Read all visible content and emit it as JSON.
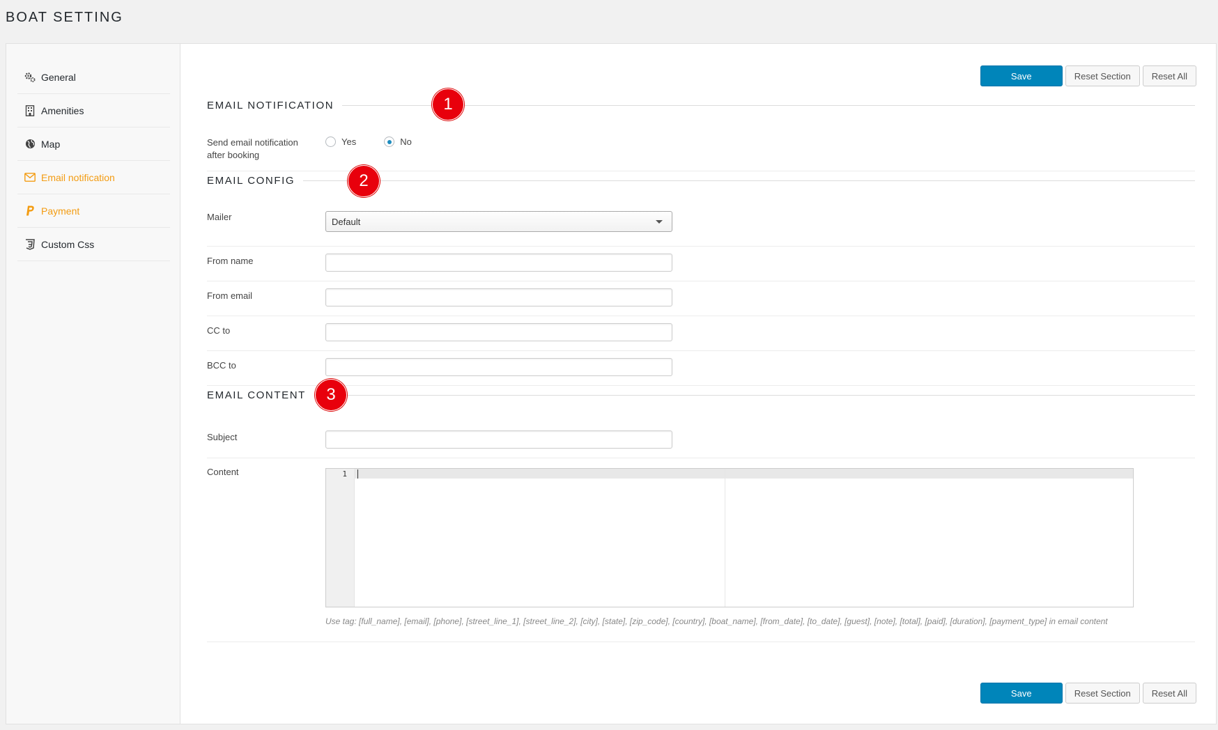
{
  "page": {
    "title": "BOAT SETTING"
  },
  "sidebar": {
    "items": [
      {
        "label": "General",
        "icon": "gears-icon"
      },
      {
        "label": "Amenities",
        "icon": "building-icon"
      },
      {
        "label": "Map",
        "icon": "globe-icon"
      },
      {
        "label": "Email notification",
        "icon": "envelope-icon",
        "active": true
      },
      {
        "label": "Payment",
        "icon": "paypal-icon"
      },
      {
        "label": "Custom Css",
        "icon": "css3-icon"
      }
    ],
    "active_color": "#f39c12"
  },
  "toolbar": {
    "save_label": "Save",
    "reset_section_label": "Reset Section",
    "reset_all_label": "Reset All",
    "primary_color": "#0085ba"
  },
  "sections": {
    "notification": {
      "title": "EMAIL NOTIFICATION",
      "marker": "1"
    },
    "config": {
      "title": "EMAIL CONFIG",
      "marker": "2"
    },
    "content": {
      "title": "EMAIL CONTENT",
      "marker": "3"
    }
  },
  "notification": {
    "label_line1": "Send email notification",
    "label_line2": "after booking",
    "options": [
      "Yes",
      "No"
    ],
    "selected": "No"
  },
  "config": {
    "mailer_label": "Mailer",
    "mailer_value": "Default",
    "from_name_label": "From name",
    "from_name_value": "",
    "from_email_label": "From email",
    "from_email_value": "",
    "cc_label": "CC to",
    "cc_value": "",
    "bcc_label": "BCC to",
    "bcc_value": ""
  },
  "content": {
    "subject_label": "Subject",
    "subject_value": "",
    "content_label": "Content",
    "editor_line_number": "1",
    "hint": "Use tag: [full_name], [email], [phone], [street_line_1], [street_line_2], [city], [state], [zip_code], [country], [boat_name], [from_date], [to_date], [guest], [note], [total], [paid], [duration], [payment_type] in email content"
  },
  "marker_color": "#e8000c"
}
